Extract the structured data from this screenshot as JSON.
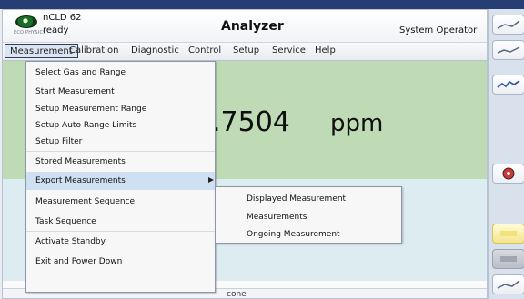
{
  "app": {
    "device_name": "nCLD 62",
    "device_status": "ready",
    "title": "Analyzer",
    "user": "System Operator",
    "logo_subtext": "ECO PHYSICS"
  },
  "menubar": {
    "items": [
      {
        "label": "Measurement",
        "active": true
      },
      {
        "label": "Calibration",
        "active": false
      },
      {
        "label": "Diagnostic",
        "active": false
      },
      {
        "label": "Control",
        "active": false
      },
      {
        "label": "Setup",
        "active": false
      },
      {
        "label": "Service",
        "active": false
      },
      {
        "label": "Help",
        "active": false
      }
    ]
  },
  "main": {
    "reading_value": ".7504",
    "reading_unit": "ppm",
    "status_text": "cone"
  },
  "dropdown": {
    "items": [
      "Select Gas and Range",
      "Start Measurement",
      "Setup Measurement Range",
      "Setup Auto Range Limits",
      "Setup Filter",
      "Stored Measurements",
      "Export Measurements",
      "Measurement Sequence",
      "Task Sequence",
      "Activate Standby",
      "Exit and Power Down"
    ],
    "highlighted_index": 6
  },
  "submenu": {
    "items": [
      "Displayed Measurement",
      "Measurements",
      "Ongoing Measurement"
    ]
  },
  "right_panel": {
    "buttons": [
      {
        "icon": "chart-icon"
      },
      {
        "icon": "chart-icon"
      },
      {
        "icon": "trend-icon"
      },
      {
        "icon": "alarm-icon"
      },
      {
        "icon": "yellow-indicator"
      },
      {
        "icon": "gray-indicator"
      },
      {
        "icon": "chart-icon"
      }
    ]
  },
  "colors": {
    "top_bar": "#263e74",
    "green_panel": "#bedbb5",
    "blue_panel": "#dcecf1",
    "highlight": "#cfe0f3"
  }
}
